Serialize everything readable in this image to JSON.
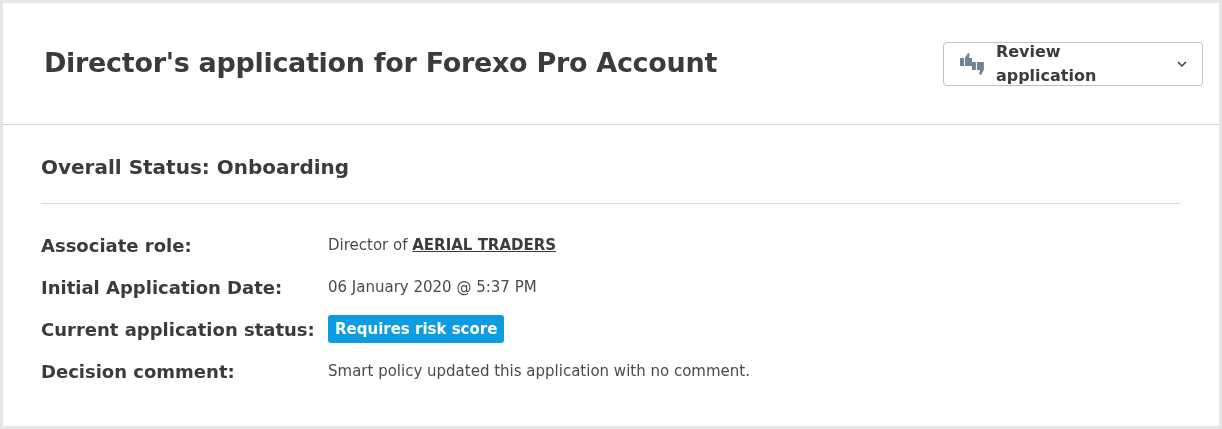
{
  "header": {
    "title": "Director's application for Forexo Pro Account",
    "action_button": {
      "label": "Review application"
    }
  },
  "overall_status": "Overall Status: Onboarding",
  "details": [
    {
      "kind": "link",
      "label": "Associate role:",
      "prefix": "Director of ",
      "link": "AERIAL TRADERS"
    },
    {
      "kind": "text",
      "label": "Initial Application Date:",
      "value": "06 January 2020 @ 5:37 PM"
    },
    {
      "kind": "badge",
      "label": "Current application status:",
      "value": "Requires risk score",
      "color": "#0e9be0"
    },
    {
      "kind": "text",
      "label": "Decision comment:",
      "value": "Smart policy updated this application with no comment."
    }
  ]
}
